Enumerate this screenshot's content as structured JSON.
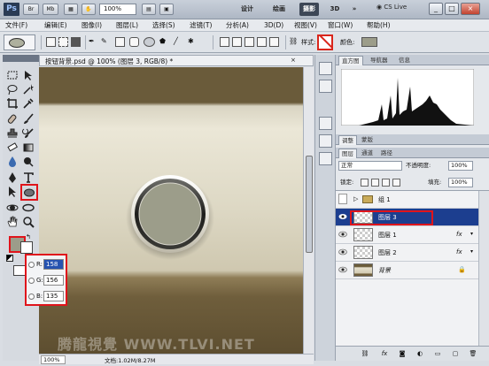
{
  "appbar": {
    "logo": "Ps",
    "buttons": [
      "Br",
      "Mb"
    ],
    "zoom": "100%",
    "workspaces": [
      "设计",
      "绘画",
      "摄影",
      "3D"
    ],
    "active_workspace": "摄影",
    "more": "»",
    "cs_live": "CS Live",
    "controls": [
      "_",
      "□",
      "×"
    ]
  },
  "menu": [
    "文件(F)",
    "编辑(E)",
    "图像(I)",
    "图层(L)",
    "选择(S)",
    "滤镜(T)",
    "分析(A)",
    "3D(D)",
    "视图(V)",
    "窗口(W)",
    "帮助(H)"
  ],
  "options": {
    "style_label": "样式:",
    "color_label": "颜色:",
    "color_value": "#9c9d8a"
  },
  "document": {
    "tab_title": "按钮背景.psd @ 100% (图层 3, RGB/8) *",
    "zoom": "100%",
    "info": "文档:1.02M/8.27M",
    "watermark": "腾龍視覺 WWW.TLVI.NET"
  },
  "picker": {
    "rows": [
      {
        "label": "R:",
        "value": "158"
      },
      {
        "label": "G:",
        "value": "156"
      },
      {
        "label": "B:",
        "value": "135"
      }
    ]
  },
  "panels": {
    "top_tabs": [
      "直方图",
      "导航器",
      "信息"
    ],
    "mid_tabs": [
      "调整",
      "蒙版"
    ],
    "layer_tabs": [
      "图层",
      "通道",
      "路径"
    ],
    "blend_mode": "正常",
    "opacity_label": "不透明度:",
    "opacity": "100%",
    "lock_label": "锁定:",
    "fill_label": "填充:",
    "fill": "100%"
  },
  "layers": [
    {
      "name": "组 1",
      "type": "group",
      "selected": false,
      "fx": false
    },
    {
      "name": "图层 3",
      "type": "layer",
      "selected": true,
      "fx": false
    },
    {
      "name": "图层 1",
      "type": "layer",
      "selected": false,
      "fx": true
    },
    {
      "name": "图层 2",
      "type": "layer",
      "selected": false,
      "fx": true
    },
    {
      "name": "背景",
      "type": "background",
      "selected": false,
      "fx": false
    }
  ],
  "fx_label": "fx"
}
